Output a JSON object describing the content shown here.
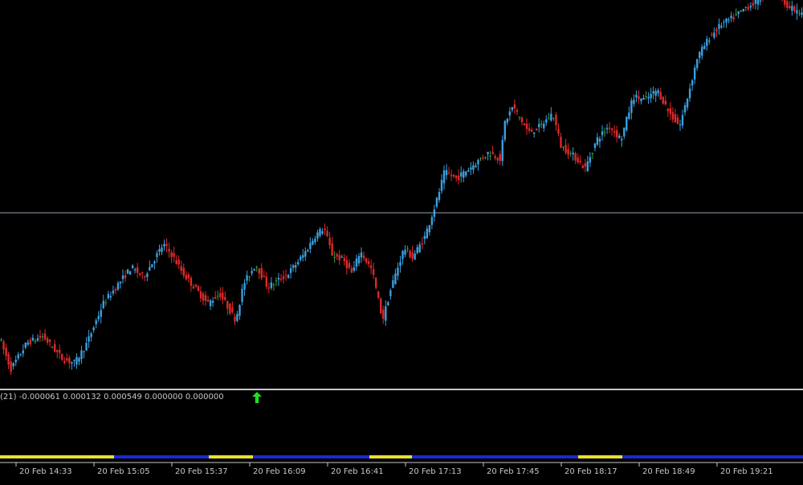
{
  "colors": {
    "background": "#000000",
    "bull": "#3aa0e0",
    "bear": "#e02828",
    "doji": "#3c9c3c",
    "hline": "#9aa0b0",
    "separator": "#c8c8c8",
    "arrow": "#22dd22",
    "strip_a": "#e8e030",
    "strip_b": "#1a2ad0",
    "text": "#c8c8c8"
  },
  "indicator": {
    "label": "(21) -0.000061 0.000132 0.000549 0.000000 0.000000",
    "arrow_icon": "arrow-up-icon"
  },
  "chart_data": {
    "type": "candlestick",
    "x_ticks": [
      "20 Feb 14:33",
      "20 Feb 15:05",
      "20 Feb 15:37",
      "20 Feb 16:09",
      "20 Feb 16:41",
      "20 Feb 17:13",
      "20 Feb 17:45",
      "20 Feb 18:17",
      "20 Feb 18:49",
      "20 Feb 19:21"
    ],
    "horizontal_line_level": 0.54,
    "y_range": [
      0,
      1
    ],
    "y_axis_shown": false,
    "bar_strip": [
      {
        "end": 0.142,
        "state": "a"
      },
      {
        "end": 0.26,
        "state": "b"
      },
      {
        "end": 0.315,
        "state": "a"
      },
      {
        "end": 0.46,
        "state": "b"
      },
      {
        "end": 0.513,
        "state": "a"
      },
      {
        "end": 0.72,
        "state": "b"
      },
      {
        "end": 0.775,
        "state": "a"
      },
      {
        "end": 1.0,
        "state": "b"
      }
    ],
    "price_path": [
      [
        0,
        0.12
      ],
      [
        0.015,
        0.02
      ],
      [
        0.035,
        0.1
      ],
      [
        0.055,
        0.12
      ],
      [
        0.08,
        0.05
      ],
      [
        0.095,
        0.04
      ],
      [
        0.11,
        0.1
      ],
      [
        0.13,
        0.22
      ],
      [
        0.165,
        0.33
      ],
      [
        0.18,
        0.3
      ],
      [
        0.205,
        0.4
      ],
      [
        0.215,
        0.37
      ],
      [
        0.23,
        0.31
      ],
      [
        0.26,
        0.22
      ],
      [
        0.275,
        0.25
      ],
      [
        0.295,
        0.17
      ],
      [
        0.305,
        0.28
      ],
      [
        0.32,
        0.34
      ],
      [
        0.335,
        0.27
      ],
      [
        0.36,
        0.31
      ],
      [
        0.38,
        0.37
      ],
      [
        0.395,
        0.43
      ],
      [
        0.405,
        0.45
      ],
      [
        0.415,
        0.37
      ],
      [
        0.43,
        0.35
      ],
      [
        0.44,
        0.31
      ],
      [
        0.45,
        0.38
      ],
      [
        0.465,
        0.32
      ],
      [
        0.478,
        0.17
      ],
      [
        0.49,
        0.28
      ],
      [
        0.505,
        0.39
      ],
      [
        0.515,
        0.36
      ],
      [
        0.53,
        0.42
      ],
      [
        0.545,
        0.53
      ],
      [
        0.555,
        0.62
      ],
      [
        0.57,
        0.6
      ],
      [
        0.59,
        0.64
      ],
      [
        0.61,
        0.68
      ],
      [
        0.625,
        0.66
      ],
      [
        0.63,
        0.77
      ],
      [
        0.64,
        0.82
      ],
      [
        0.66,
        0.74
      ],
      [
        0.675,
        0.76
      ],
      [
        0.69,
        0.8
      ],
      [
        0.7,
        0.7
      ],
      [
        0.72,
        0.66
      ],
      [
        0.73,
        0.63
      ],
      [
        0.745,
        0.72
      ],
      [
        0.76,
        0.76
      ],
      [
        0.775,
        0.72
      ],
      [
        0.79,
        0.85
      ],
      [
        0.805,
        0.84
      ],
      [
        0.82,
        0.87
      ],
      [
        0.835,
        0.8
      ],
      [
        0.848,
        0.76
      ],
      [
        0.86,
        0.87
      ],
      [
        0.87,
        0.97
      ],
      [
        0.885,
        1.03
      ],
      [
        0.9,
        1.07
      ],
      [
        0.915,
        1.09
      ],
      [
        0.93,
        1.12
      ],
      [
        0.945,
        1.14
      ],
      [
        0.962,
        1.18
      ],
      [
        0.975,
        1.15
      ],
      [
        0.985,
        1.12
      ],
      [
        1.0,
        1.1
      ]
    ]
  }
}
